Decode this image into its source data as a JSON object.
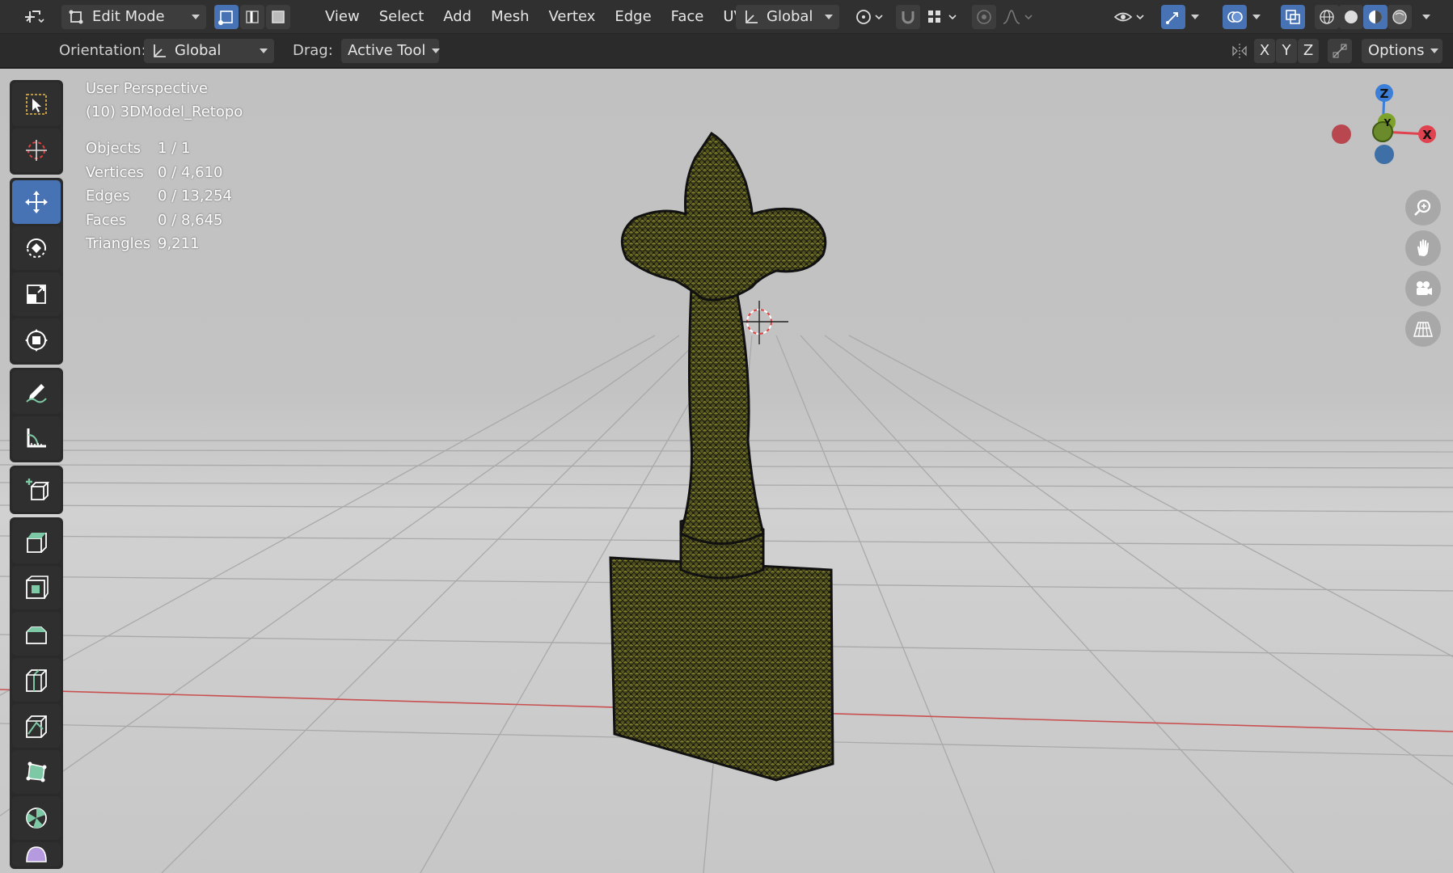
{
  "header": {
    "mode": "Edit Mode",
    "menu": [
      "View",
      "Select",
      "Add",
      "Mesh",
      "Vertex",
      "Edge",
      "Face",
      "UV"
    ],
    "transform_orientation": "Global"
  },
  "toolsettings": {
    "orientation_label": "Orientation:",
    "orientation_value": "Global",
    "drag_label": "Drag:",
    "drag_value": "Active Tool",
    "axis_x": "X",
    "axis_y": "Y",
    "axis_z": "Z",
    "options_label": "Options"
  },
  "viewport": {
    "view_name": "User Perspective",
    "object_name": "(10) 3DModel_Retopo",
    "stats": [
      {
        "label": "Objects",
        "value": "1 / 1"
      },
      {
        "label": "Vertices",
        "value": "0 / 4,610"
      },
      {
        "label": "Edges",
        "value": "0 / 13,254"
      },
      {
        "label": "Faces",
        "value": "0 / 8,645"
      },
      {
        "label": "Triangles",
        "value": "9,211"
      }
    ],
    "gizmo": {
      "x": "X",
      "y": "Y",
      "z": "Z"
    }
  },
  "colors": {
    "accent": "#4772b3",
    "axis_x": "#e0424f",
    "axis_y": "#7ea32a",
    "axis_z": "#3b7fd8"
  },
  "tools": [
    "select-box",
    "cursor",
    "move",
    "rotate",
    "scale",
    "transform",
    "annotate",
    "measure",
    "add-cube",
    "extrude",
    "inset",
    "bevel",
    "loop-cut",
    "knife",
    "poly-build",
    "spin",
    "smooth"
  ]
}
